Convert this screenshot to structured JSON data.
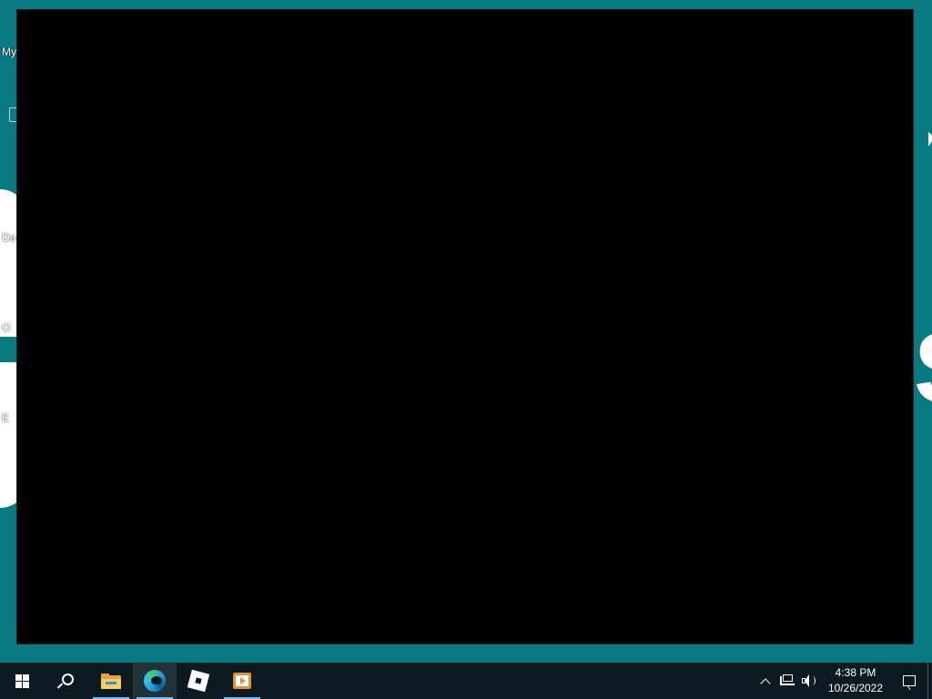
{
  "desktop": {
    "icons": [
      {
        "label": "My"
      },
      {
        "label": "Da"
      },
      {
        "label": "O"
      },
      {
        "label": "E"
      }
    ]
  },
  "taskbar": {
    "apps": [
      {
        "name": "file-explorer",
        "icon": "folder-icon",
        "running": true
      },
      {
        "name": "edge",
        "icon": "edge-icon",
        "running": true,
        "active": true
      },
      {
        "name": "roblox",
        "icon": "roblox-icon",
        "running": false
      },
      {
        "name": "media-player",
        "icon": "media-icon",
        "running": true
      }
    ],
    "clock": {
      "time": "4:38 PM",
      "date": "10/26/2022"
    }
  },
  "colors": {
    "desktop_background": "#0a7a82",
    "taskbar_background": "#0b1b21",
    "window_background": "#000000",
    "running_indicator": "#76b9ed"
  }
}
